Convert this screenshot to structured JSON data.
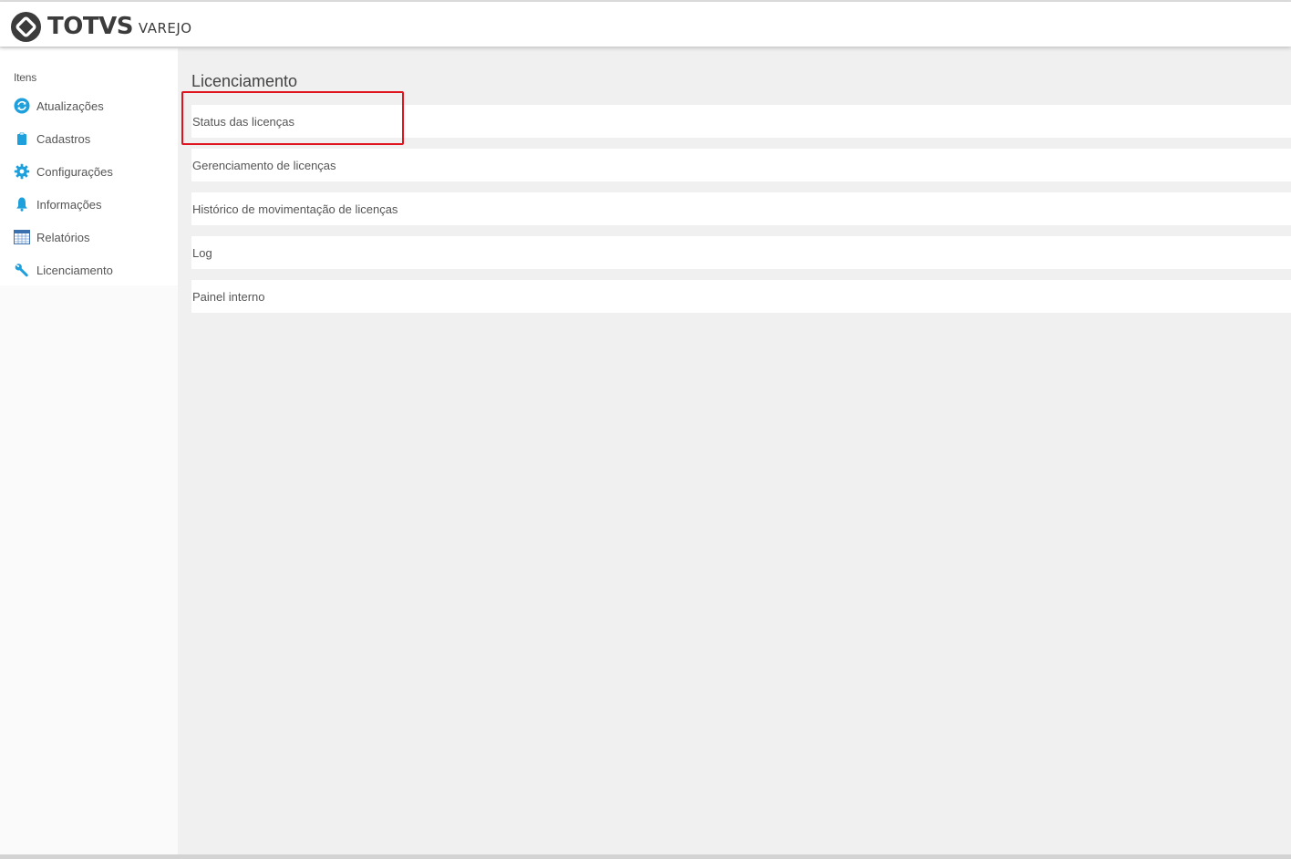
{
  "header": {
    "brand": "TOTVS",
    "product": "VAREJO"
  },
  "sidebar": {
    "title": "Itens",
    "items": [
      {
        "label": "Atualizações",
        "icon": "refresh-icon"
      },
      {
        "label": "Cadastros",
        "icon": "clipboard-icon"
      },
      {
        "label": "Configurações",
        "icon": "gear-icon"
      },
      {
        "label": "Informações",
        "icon": "bell-icon"
      },
      {
        "label": "Relatórios",
        "icon": "report-grid-icon"
      },
      {
        "label": "Licenciamento",
        "icon": "wrench-icon"
      }
    ]
  },
  "main": {
    "title": "Licenciamento",
    "items": [
      {
        "label": "Status das licenças"
      },
      {
        "label": "Gerenciamento de licenças"
      },
      {
        "label": "Histórico de movimentação de licenças"
      },
      {
        "label": "Log"
      },
      {
        "label": "Painel interno"
      }
    ]
  },
  "colors": {
    "accent": "#1ea0dc",
    "highlight": "#e0141e",
    "logo": "#3c3c3c"
  }
}
